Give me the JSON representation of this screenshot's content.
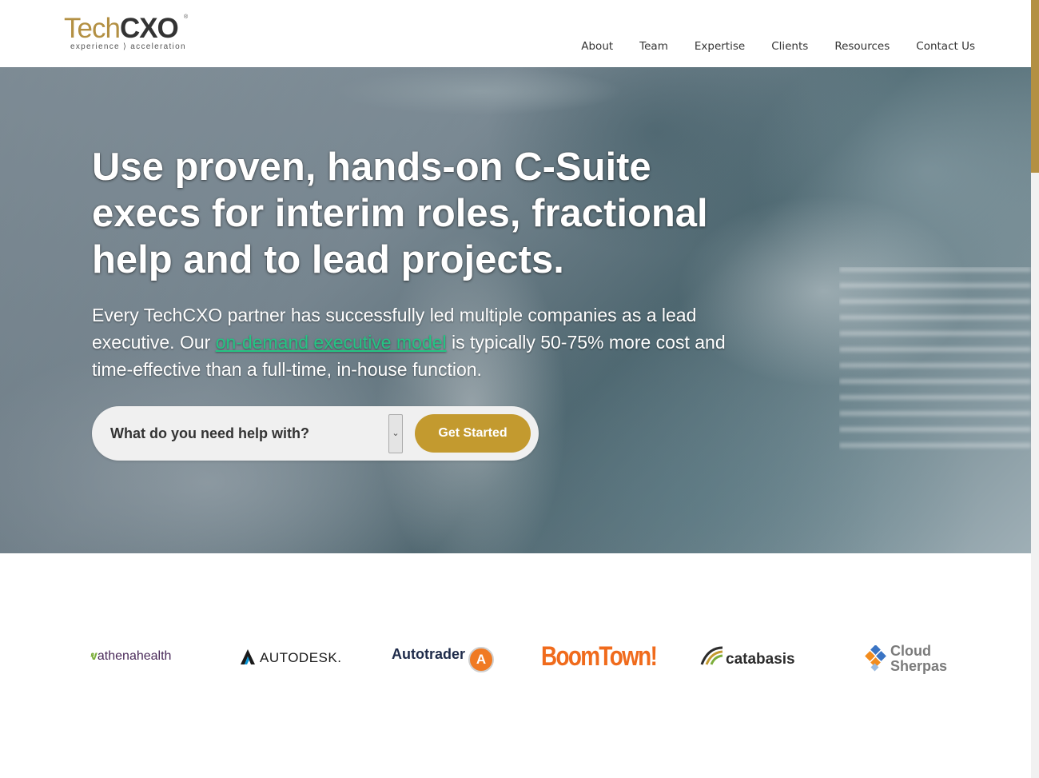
{
  "brand": {
    "logo_part1": "Tech",
    "logo_part2": "CXO",
    "registered": "®",
    "tagline": "experience ⟩ acceleration"
  },
  "nav": {
    "items": [
      "About",
      "Team",
      "Expertise",
      "Clients",
      "Resources",
      "Contact Us"
    ]
  },
  "hero": {
    "heading": "Use proven, hands-on C-Suite execs for interim roles, fractional help and to lead projects.",
    "body_before_link": "Every TechCXO partner has successfully led multiple companies as a lead executive. Our ",
    "link_text": "on-demand executive model",
    "body_after_link": " is typically 50-75% more cost and time-effective than a full-time, in-house function.",
    "select_label": "What do you need help with?",
    "cta_label": "Get Started"
  },
  "clients": {
    "athena_leaf": "ⱴ",
    "athena": "athenahealth",
    "autodesk": "AUTODESK.",
    "autotrader": "Autotrader",
    "autotrader_mark": "A",
    "boomtown": "BoomTown!",
    "catabasis": "catabasis",
    "cloud_line1": "Cloud",
    "cloud_line2": "Sherpas"
  },
  "colors": {
    "brand_gold": "#b39043",
    "cta_gold": "#c39a2f",
    "link_green": "#25c383",
    "scrollbar_thumb": "#b39043"
  }
}
